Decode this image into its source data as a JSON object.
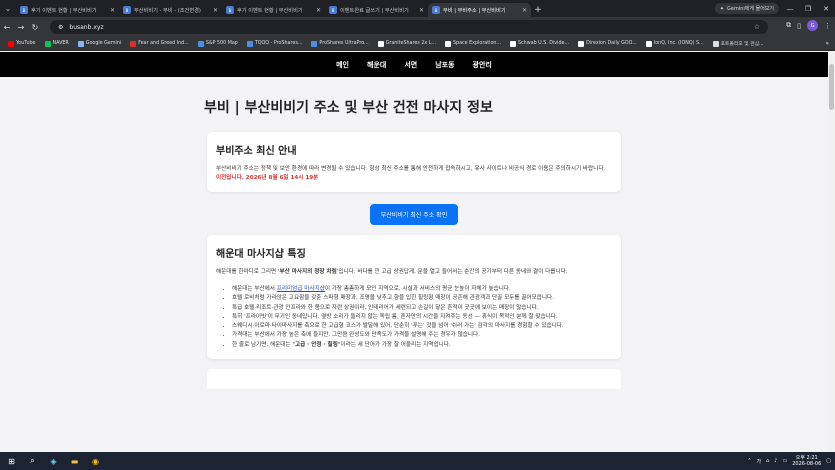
{
  "browser": {
    "tabs": [
      {
        "title": "후기 이벤트 현황 | 부산비비기",
        "fav": "B"
      },
      {
        "title": "부산비비기 - 부비 - (조건변경)",
        "fav": "B"
      },
      {
        "title": "후기 이벤트 현황 | 부산비비기",
        "fav": "B"
      },
      {
        "title": "이벤트완료 글쓰기 | 부산비비기",
        "fav": "B"
      },
      {
        "title": "부비 | 부비주소 | 부산비비기",
        "fav": "B"
      }
    ],
    "gemini_label": "Gemini에게 물어보기",
    "url": "busanb.xyz",
    "avatar_letter": "G",
    "bookmarks": [
      {
        "label": "YouTube",
        "color": "#ff0000"
      },
      {
        "label": "NAVER",
        "color": "#03c75a"
      },
      {
        "label": "Google Gemini",
        "color": "#8ab4f8"
      },
      {
        "label": "Fear and Greed Ind...",
        "color": "#d93025"
      },
      {
        "label": "S&P 500 Map",
        "color": "#4a90e2"
      },
      {
        "label": "TQQQ - ProShares...",
        "color": "#4a90e2"
      },
      {
        "label": "ProShares UltraPro...",
        "color": "#4a90e2"
      },
      {
        "label": "GraniteShares 2x L...",
        "color": "#ffffff"
      },
      {
        "label": "Space Exploration...",
        "color": "#ffffff"
      },
      {
        "label": "Schwab U.S. Divide...",
        "color": "#ffffff"
      },
      {
        "label": "Direxion Daily GOO...",
        "color": "#ffffff"
      },
      {
        "label": "IonQ, Inc. (IONQ) S...",
        "color": "#ffffff"
      },
      {
        "label": "포트폴리오 및 관심...",
        "color": "#dddddd"
      }
    ]
  },
  "site": {
    "nav": [
      "메인",
      "해운대",
      "서면",
      "남포동",
      "광안리"
    ],
    "page_title": "부비 | 부산비비기 주소 및 부산 건전 마사지 정보",
    "notice": {
      "heading": "부비주소 최신 안내",
      "body": "부산비비기 주소는 정책 및 보안 환경에 따라 변경될 수 있습니다. 항상 최신 주소를 통해 안전하게 접속하시고, 유사 사이트나 비공식 경로 이용은 주의하시기 바랍니다.",
      "highlight": "이전입니다. 2026년 8월 6일 14시 19분"
    },
    "cta_label": "부산비비기 최신 주소 확인",
    "feature": {
      "heading": "해운대 마사지샵 특징",
      "intro_pre": "해운대를 한마디로 그리면 '",
      "intro_bold": "부산 마사지의 정장 차림",
      "intro_post": "'입니다. 바다를 낀 고급 상권답게, 문을 열고 들어서는 순간의 공기부터 다른 동네와 결이 다릅니다.",
      "bullet1_pre": "해운대는 부산에서 ",
      "bullet1_link": "프리미엄급 마사지샵",
      "bullet1_post": "이 가장 촘촘하게 모인 지역으로, 시설과 서비스의 평균 눈높이 자체가 높습니다.",
      "bullets": [
        "호텔 로비처럼 가라앉은 고요함을 갖춘 스파형 매장과, 조명을 낮추고 향을 입힌 힐링형 매장이 공존해 관광객과 단골 모두를 끌어모읍니다.",
        "특급 호텔·리조트·관광 인프라와 한 몸으로 자란 상권이라, 인테리어가 세련되고 손길이 닿은 흔적이 곳곳에 보이는 매장이 많습니다.",
        "특히 '프라이빗'이 무기인 동네입니다. 옆방 소리가 들리지 않는 독립 룸, 혼자만의 시간을 지켜주는 동선 — 휴식이 목적인 분께 잘 맞습니다.",
        "스웨디시·아로마·타이마사지를 축으로 한 고급형 코스가 발달해 있어, 단순히 '푸는' 것을 넘어 '쉬러 가는' 감각의 마사지를 경험할 수 있습니다.",
        "가격대는 부산에서 가장 높은 축에 들지만, 그만큼 완성도와 만족도가 가격을 설명해 주는 경우가 많습니다."
      ],
      "last_pre": "한 줄로 남기면, 해운대는 \"",
      "last_bold": "고급 · 안정 · 힐링",
      "last_post": "\"이라는 세 단어가 가장 잘 어울리는 지역입니다."
    }
  },
  "taskbar": {
    "time": "오후 2:21",
    "date": "2026-08-06"
  }
}
